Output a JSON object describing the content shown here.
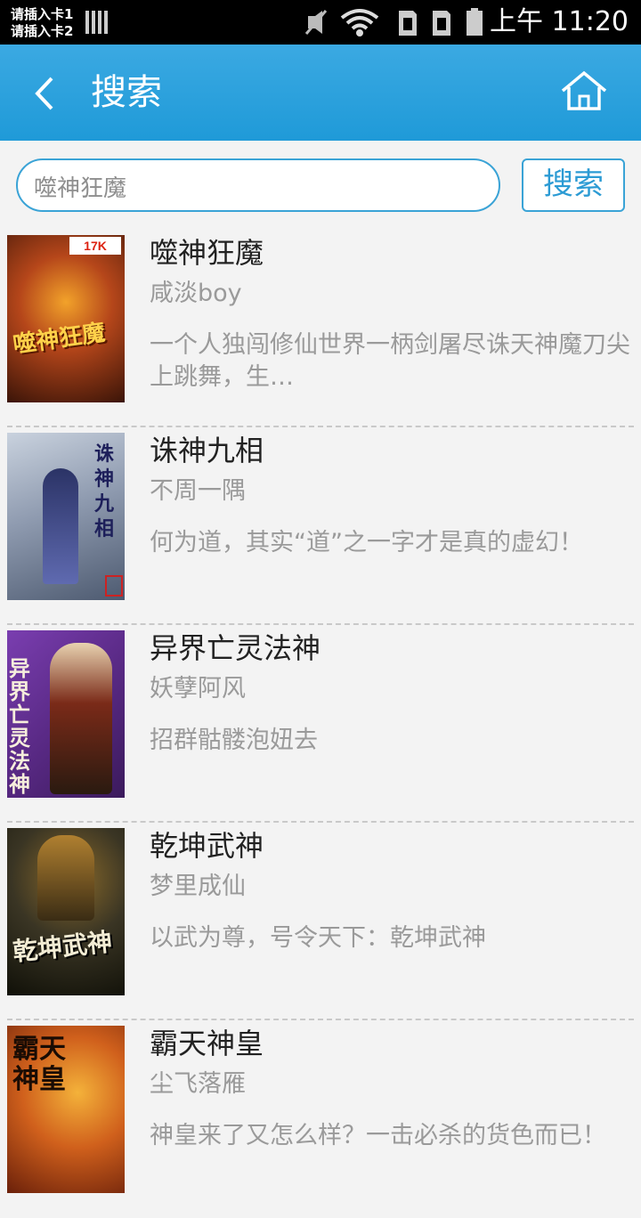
{
  "status_bar": {
    "sim1": "请插入卡1",
    "sim2": "请插入卡2",
    "time": "上午 11:20"
  },
  "header": {
    "title": "搜索"
  },
  "search": {
    "value": "噬神狂魔",
    "button_label": "搜索"
  },
  "results": [
    {
      "title": "噬神狂魔",
      "author": "咸淡boy",
      "description": "一个人独闯修仙世界一柄剑屠尽诛天神魔刀尖上跳舞，生…",
      "cover": {
        "bg": "#6b2410",
        "accent": "#f0a020",
        "text": "噬神狂魔",
        "badge": "17K"
      }
    },
    {
      "title": "诛神九相",
      "author": "不周一隅",
      "description": "何为道，其实“道”之一字才是真的虚幻！",
      "cover": {
        "bg": "#7d8aa0",
        "accent": "#2a2e6e",
        "text": "诛神九相"
      }
    },
    {
      "title": "异界亡灵法神",
      "author": "妖孽阿风",
      "description": "招群骷髅泡妞去",
      "cover": {
        "bg": "#5a2a86",
        "accent": "#f2e6d0",
        "text": "异界亡灵法神"
      }
    },
    {
      "title": "乾坤武神",
      "author": "梦里成仙",
      "description": "以武为尊，号令天下：乾坤武神",
      "cover": {
        "bg": "#3a3524",
        "accent": "#e8e0c0",
        "text": "乾坤武神"
      }
    },
    {
      "title": "霸天神皇",
      "author": "尘飞落雁",
      "description": "神皇来了又怎么样？一击必杀的货色而已！",
      "cover": {
        "bg": "#c0501a",
        "accent": "#2a1508",
        "text": "霸天神皇"
      }
    }
  ]
}
